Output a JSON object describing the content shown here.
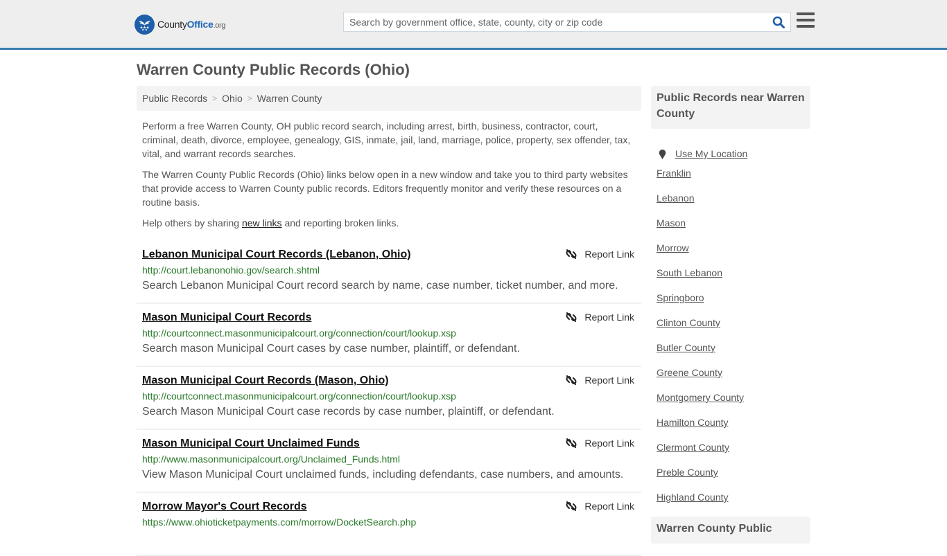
{
  "header": {
    "logo": {
      "name": "County",
      "name_accent": "Office",
      "tld": ".org",
      "icon": "eagle-stars-icon"
    },
    "search": {
      "placeholder": "Search by government office, state, county, city or zip code",
      "value": "",
      "button_icon": "search-icon"
    },
    "menu_icon": "hamburger-menu-icon"
  },
  "colors": {
    "brand_blue": "#1f66b5",
    "header_rule": "#3b7fb0",
    "url_green": "#2a7a2a"
  },
  "page": {
    "title": "Warren County Public Records (Ohio)",
    "breadcrumb": [
      {
        "label": "Public Records"
      },
      {
        "label": "Ohio"
      },
      {
        "label": "Warren County"
      }
    ],
    "breadcrumb_separator": ">",
    "intro": {
      "p1": "Perform a free Warren County, OH public record search, including arrest, birth, business, contractor, court, criminal, death, divorce, employee, genealogy, GIS, inmate, jail, land, marriage, police, property, sex offender, tax, vital, and warrant records searches.",
      "p2": "The Warren County Public Records (Ohio) links below open in a new window and take you to third party websites that provide access to Warren County public records. Editors frequently monitor and verify these resources on a routine basis.",
      "p3_before": "Help others by sharing ",
      "p3_link": "new links",
      "p3_after": " and reporting broken links."
    },
    "report_label": "Report Link",
    "records": [
      {
        "title": "Lebanon Municipal Court Records (Lebanon, Ohio)",
        "url": "http://court.lebanonohio.gov/search.shtml",
        "description": "Search Lebanon Municipal Court record search by name, case number, ticket number, and more."
      },
      {
        "title": "Mason Municipal Court Records",
        "url": "http://courtconnect.masonmunicipalcourt.org/connection/court/lookup.xsp",
        "description": "Search mason Municipal Court cases by case number, plaintiff, or defendant."
      },
      {
        "title": "Mason Municipal Court Records (Mason, Ohio)",
        "url": "http://courtconnect.masonmunicipalcourt.org/connection/court/lookup.xsp",
        "description": "Search Mason Municipal Court case records by case number, plaintiff, or defendant."
      },
      {
        "title": "Mason Municipal Court Unclaimed Funds",
        "url": "http://www.masonmunicipalcourt.org/Unclaimed_Funds.html",
        "description": "View Mason Municipal Court unclaimed funds, including defendants, case numbers, and amounts."
      },
      {
        "title": "Morrow Mayor's Court Records",
        "url": "https://www.ohioticketpayments.com/morrow/DocketSearch.php",
        "description": ""
      }
    ]
  },
  "sidebar": {
    "heading": "Public Records near Warren County",
    "use_location": "Use My Location",
    "places": [
      "Franklin",
      "Lebanon",
      "Mason",
      "Morrow",
      "South Lebanon",
      "Springboro",
      "Clinton County",
      "Butler County",
      "Greene County",
      "Montgomery County",
      "Hamilton County",
      "Clermont County",
      "Preble County",
      "Highland County"
    ],
    "heading_2": "Warren County Public"
  }
}
